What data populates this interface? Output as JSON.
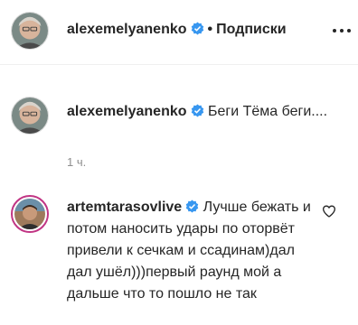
{
  "header": {
    "username": "alexemelyanenko",
    "separator": "•",
    "follow_label": "Подписки"
  },
  "post": {
    "username": "alexemelyanenko",
    "caption": "Беги Тёма беги....",
    "time": "1 ч."
  },
  "comment": {
    "username": "artemtarasovlive",
    "text": "Лучше бежать и потом наносить удары по оторвёт привели к сечкам и ссадинам)дал дал ушёл)))первый раунд мой а дальше что то пошло не так"
  },
  "icons": {
    "verified": "verified-badge-icon",
    "more": "more-options-icon",
    "like": "heart-outline-icon"
  },
  "colors": {
    "verified": "#3897f0",
    "story_ring": "#c13584",
    "secondary_text": "#8e8e8e"
  }
}
